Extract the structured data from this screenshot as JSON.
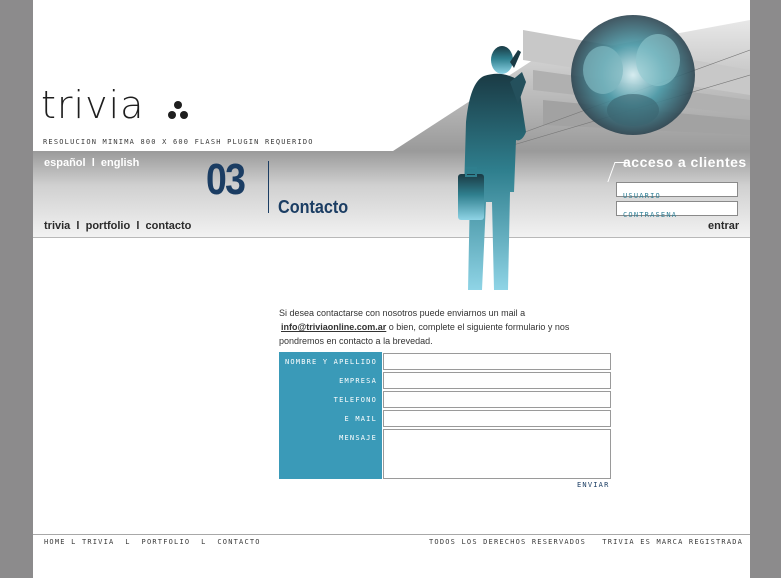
{
  "brand": {
    "logo_text": "trivia"
  },
  "header": {
    "resolution_note": "RESOLUCION MINIMA 800 x 600  FLASH PLUGIN REQUERIDO",
    "lang": {
      "es": "español",
      "sep": "l",
      "en": "english"
    },
    "nav": {
      "trivia": "trivia",
      "portfolio": "portfolio",
      "contacto": "contacto",
      "sep": "l"
    },
    "section": {
      "number": "03",
      "title": "Contacto"
    }
  },
  "client_access": {
    "title": "acceso a clientes",
    "usuario_label": "USUARIO",
    "contrasena_label": "CONTRASENA",
    "entrar_label": "entrar"
  },
  "contact": {
    "intro_line1": "Si desea contactarse con nosotros puede enviarnos un mail a",
    "email": "info@triviaonline.com.ar",
    "intro_line2_rest": " o bien, complete el siguiente formulario y nos",
    "intro_line3": "pondremos en contacto a la brevedad.",
    "labels": {
      "nombre": "NOMBRE Y APELLIDO",
      "empresa": "EMPRESA",
      "telefono": "TELEFONO",
      "email": "E MAIL",
      "mensaje": "MENSAJE"
    },
    "submit": "ENVIAR"
  },
  "footer": {
    "home": "HOME",
    "trivia": "TRIVIA",
    "portfolio": "PORTFOLIO",
    "contacto": "CONTACTO",
    "sep": "l",
    "rights": "TODOS LOS DERECHOS RESERVADOS",
    "trademark": "TRIVIA ES MARCA REGISTRADA"
  },
  "colors": {
    "accent_blue": "#3a9ab8",
    "navy": "#1b3d63",
    "page_bg": "#8c8b8c"
  }
}
